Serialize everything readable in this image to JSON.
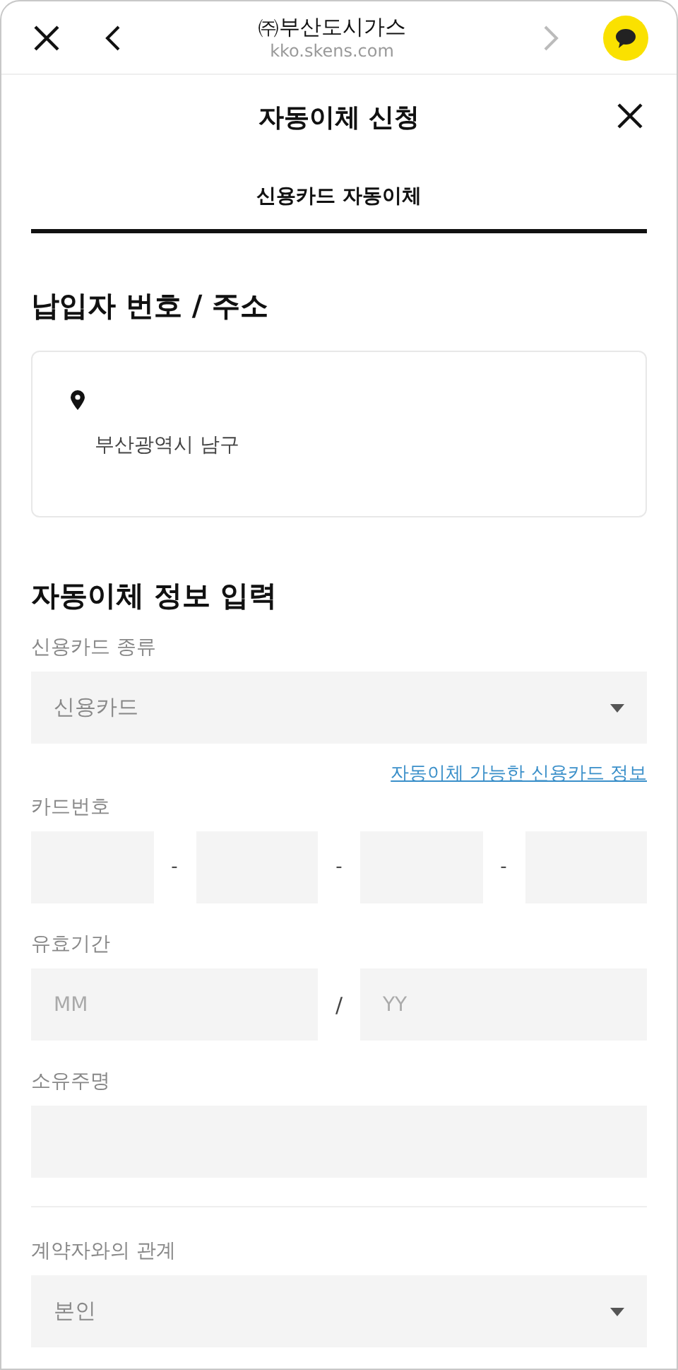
{
  "browser_bar": {
    "title": "㈜부산도시가스",
    "url": "kko.skens.com"
  },
  "header": {
    "title": "자동이체 신청"
  },
  "tabs": [
    {
      "label": "신용카드 자동이체",
      "selected": true
    }
  ],
  "payer_section": {
    "title": "납입자 번호 / 주소",
    "address": "부산광역시 남구"
  },
  "form_section": {
    "title": "자동이체 정보 입력",
    "fields": [
      {
        "kind": "select",
        "label": "신용카드 종류",
        "value": "신용카드"
      },
      {
        "kind": "link",
        "text": "자동이체 가능한 신용카드 정보"
      },
      {
        "kind": "card",
        "label": "카드번호",
        "separator": "-"
      },
      {
        "kind": "expiry",
        "label": "유효기간",
        "placeholders": [
          "MM",
          "YY"
        ],
        "separator": "/"
      },
      {
        "kind": "text",
        "label": "소유주명"
      },
      {
        "kind": "divider"
      },
      {
        "kind": "select",
        "label": "계약자와의 관계",
        "value": "본인"
      }
    ]
  }
}
